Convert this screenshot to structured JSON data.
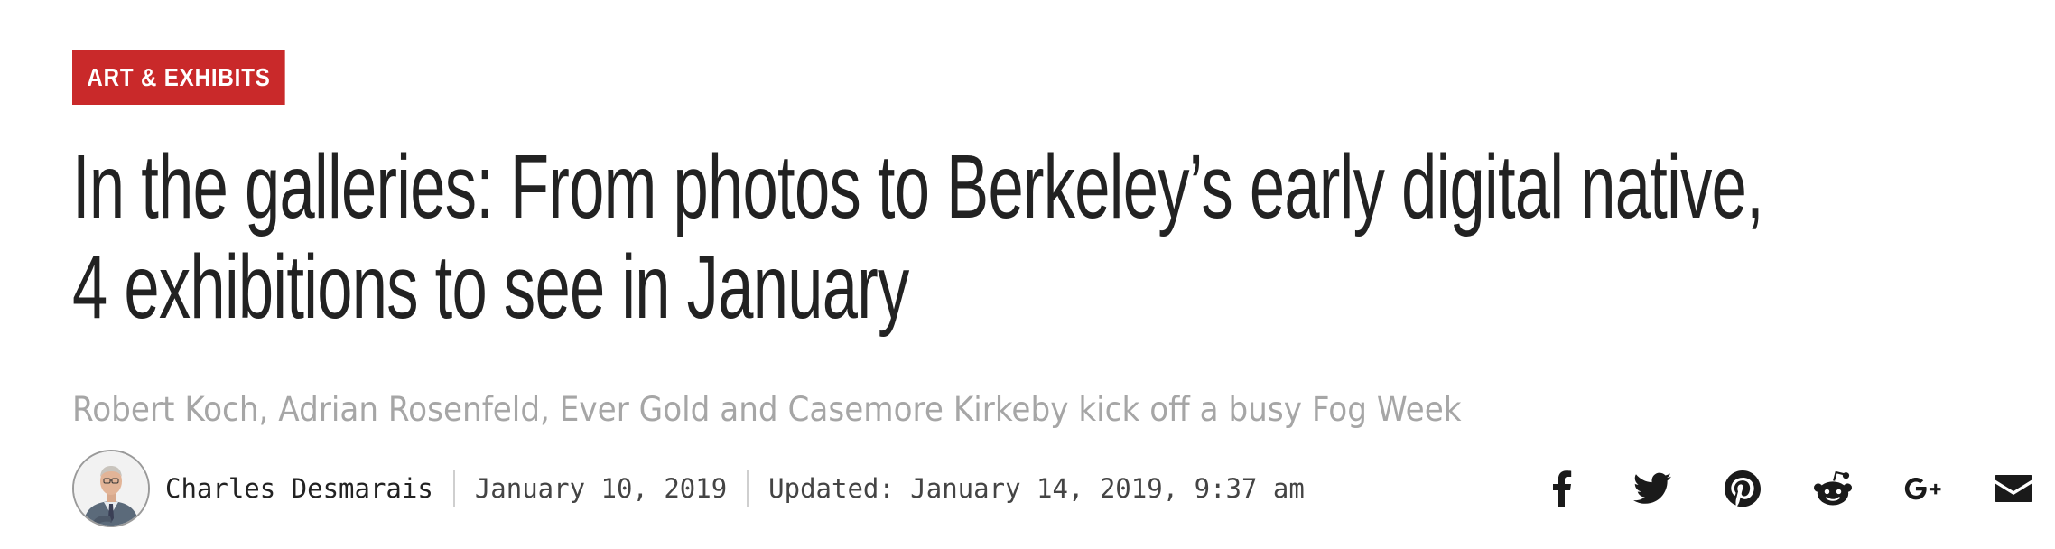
{
  "article": {
    "category": "ART & EXHIBITS",
    "headline_line1": "In the galleries: From photos to Berkeley’s early digital native,",
    "headline_line2": "4 exhibitions to see in January",
    "dek": "Robert Koch, Adrian Rosenfeld, Ever Gold and Casemore Kirkeby kick off a busy Fog Week",
    "author": "Charles Desmarais",
    "published": "January 10, 2019",
    "updated": "Updated: January 14, 2019, 9:37 am"
  },
  "share": {
    "icons": [
      "facebook-icon",
      "twitter-icon",
      "pinterest-icon",
      "reddit-icon",
      "google-plus-icon",
      "email-icon"
    ],
    "gplus_label": "G+"
  },
  "colors": {
    "category_badge": "#c9292a",
    "headline": "#222222",
    "dek": "#a6a6a6",
    "share_icons": "#1a1a1a"
  }
}
